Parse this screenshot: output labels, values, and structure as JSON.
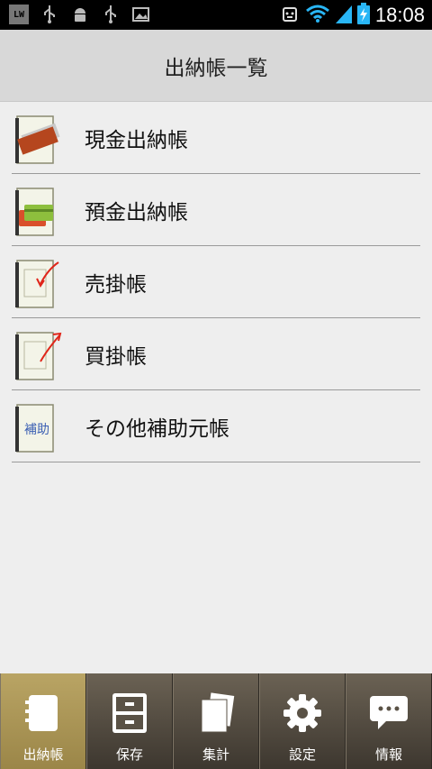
{
  "status_bar": {
    "badge": "LW",
    "left_icons": [
      "usb-icon",
      "android-icon",
      "usb-icon",
      "image-icon"
    ],
    "right_icons": [
      "robot-icon",
      "wifi-icon",
      "signal-icon",
      "battery-charging-icon"
    ],
    "time": "18:08"
  },
  "header": {
    "title": "出納帳一覧"
  },
  "list": [
    {
      "label": "現金出納帳",
      "icon": "cash-book-icon"
    },
    {
      "label": "預金出納帳",
      "icon": "bank-book-icon"
    },
    {
      "label": "売掛帳",
      "icon": "receivable-book-icon"
    },
    {
      "label": "買掛帳",
      "icon": "payable-book-icon"
    },
    {
      "label": "その他補助元帳",
      "icon": "subsidiary-book-icon",
      "icon_text": "補助"
    }
  ],
  "bottom_nav": [
    {
      "label": "出納帳",
      "icon": "notebook-icon",
      "active": true
    },
    {
      "label": "保存",
      "icon": "cabinet-icon",
      "active": false
    },
    {
      "label": "集計",
      "icon": "pages-icon",
      "active": false
    },
    {
      "label": "設定",
      "icon": "gear-icon",
      "active": false
    },
    {
      "label": "情報",
      "icon": "chat-icon",
      "active": false
    }
  ]
}
